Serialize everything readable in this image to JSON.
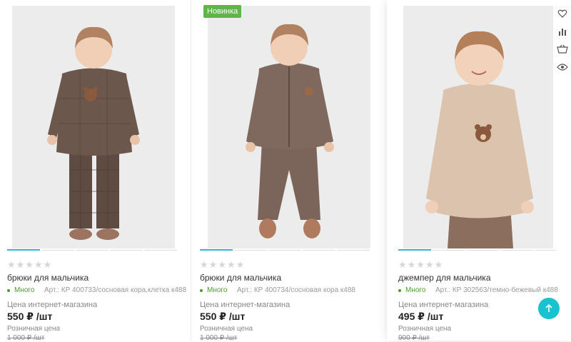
{
  "products": [
    {
      "badge": "",
      "title": "брюки для мальчика",
      "stars": "★★★★★",
      "stock": "Много",
      "article": "Арт.: КР 400733/сосновая кора,клетка к488",
      "price_label": "Цена интернет-магазина",
      "price": "550 ₽ /шт",
      "retail_label": "Розничная цена",
      "retail_price": "1 000 ₽ /шт",
      "image": "boy in brown checkered sweatshirt and pants with bear patch"
    },
    {
      "badge": "Новинка",
      "title": "брюки для мальчика",
      "stars": "★★★★★",
      "stock": "Много",
      "article": "Арт.: КР 400734/сосновая кора к488",
      "price_label": "Цена интернет-магазина",
      "price": "550 ₽ /шт",
      "retail_label": "Розничная цена",
      "retail_price": "1 000 ₽ /шт",
      "image": "boy in brown zip bomber jacket and joggers"
    },
    {
      "badge": "",
      "title": "джемпер для мальчика",
      "stars": "★★★★★",
      "stock": "Много",
      "article": "Арт.: КР 302563/темно-бежевый к488",
      "price_label": "Цена интернет-магазина",
      "price": "495 ₽ /шт",
      "retail_label": "Розничная цена",
      "retail_price": "900 ₽ /шт",
      "image": "boy in beige jumper with bear face"
    }
  ],
  "card_actions": [
    "heart-icon",
    "compare-chart-icon",
    "basket-icon",
    "eye-icon"
  ],
  "colors": {
    "accent": "#19c2cf",
    "badge": "#5fb548",
    "stock": "#4b9a2b",
    "slider_active": "#36b5d6"
  },
  "scroll_top": {
    "icon": "arrow-up-icon"
  }
}
